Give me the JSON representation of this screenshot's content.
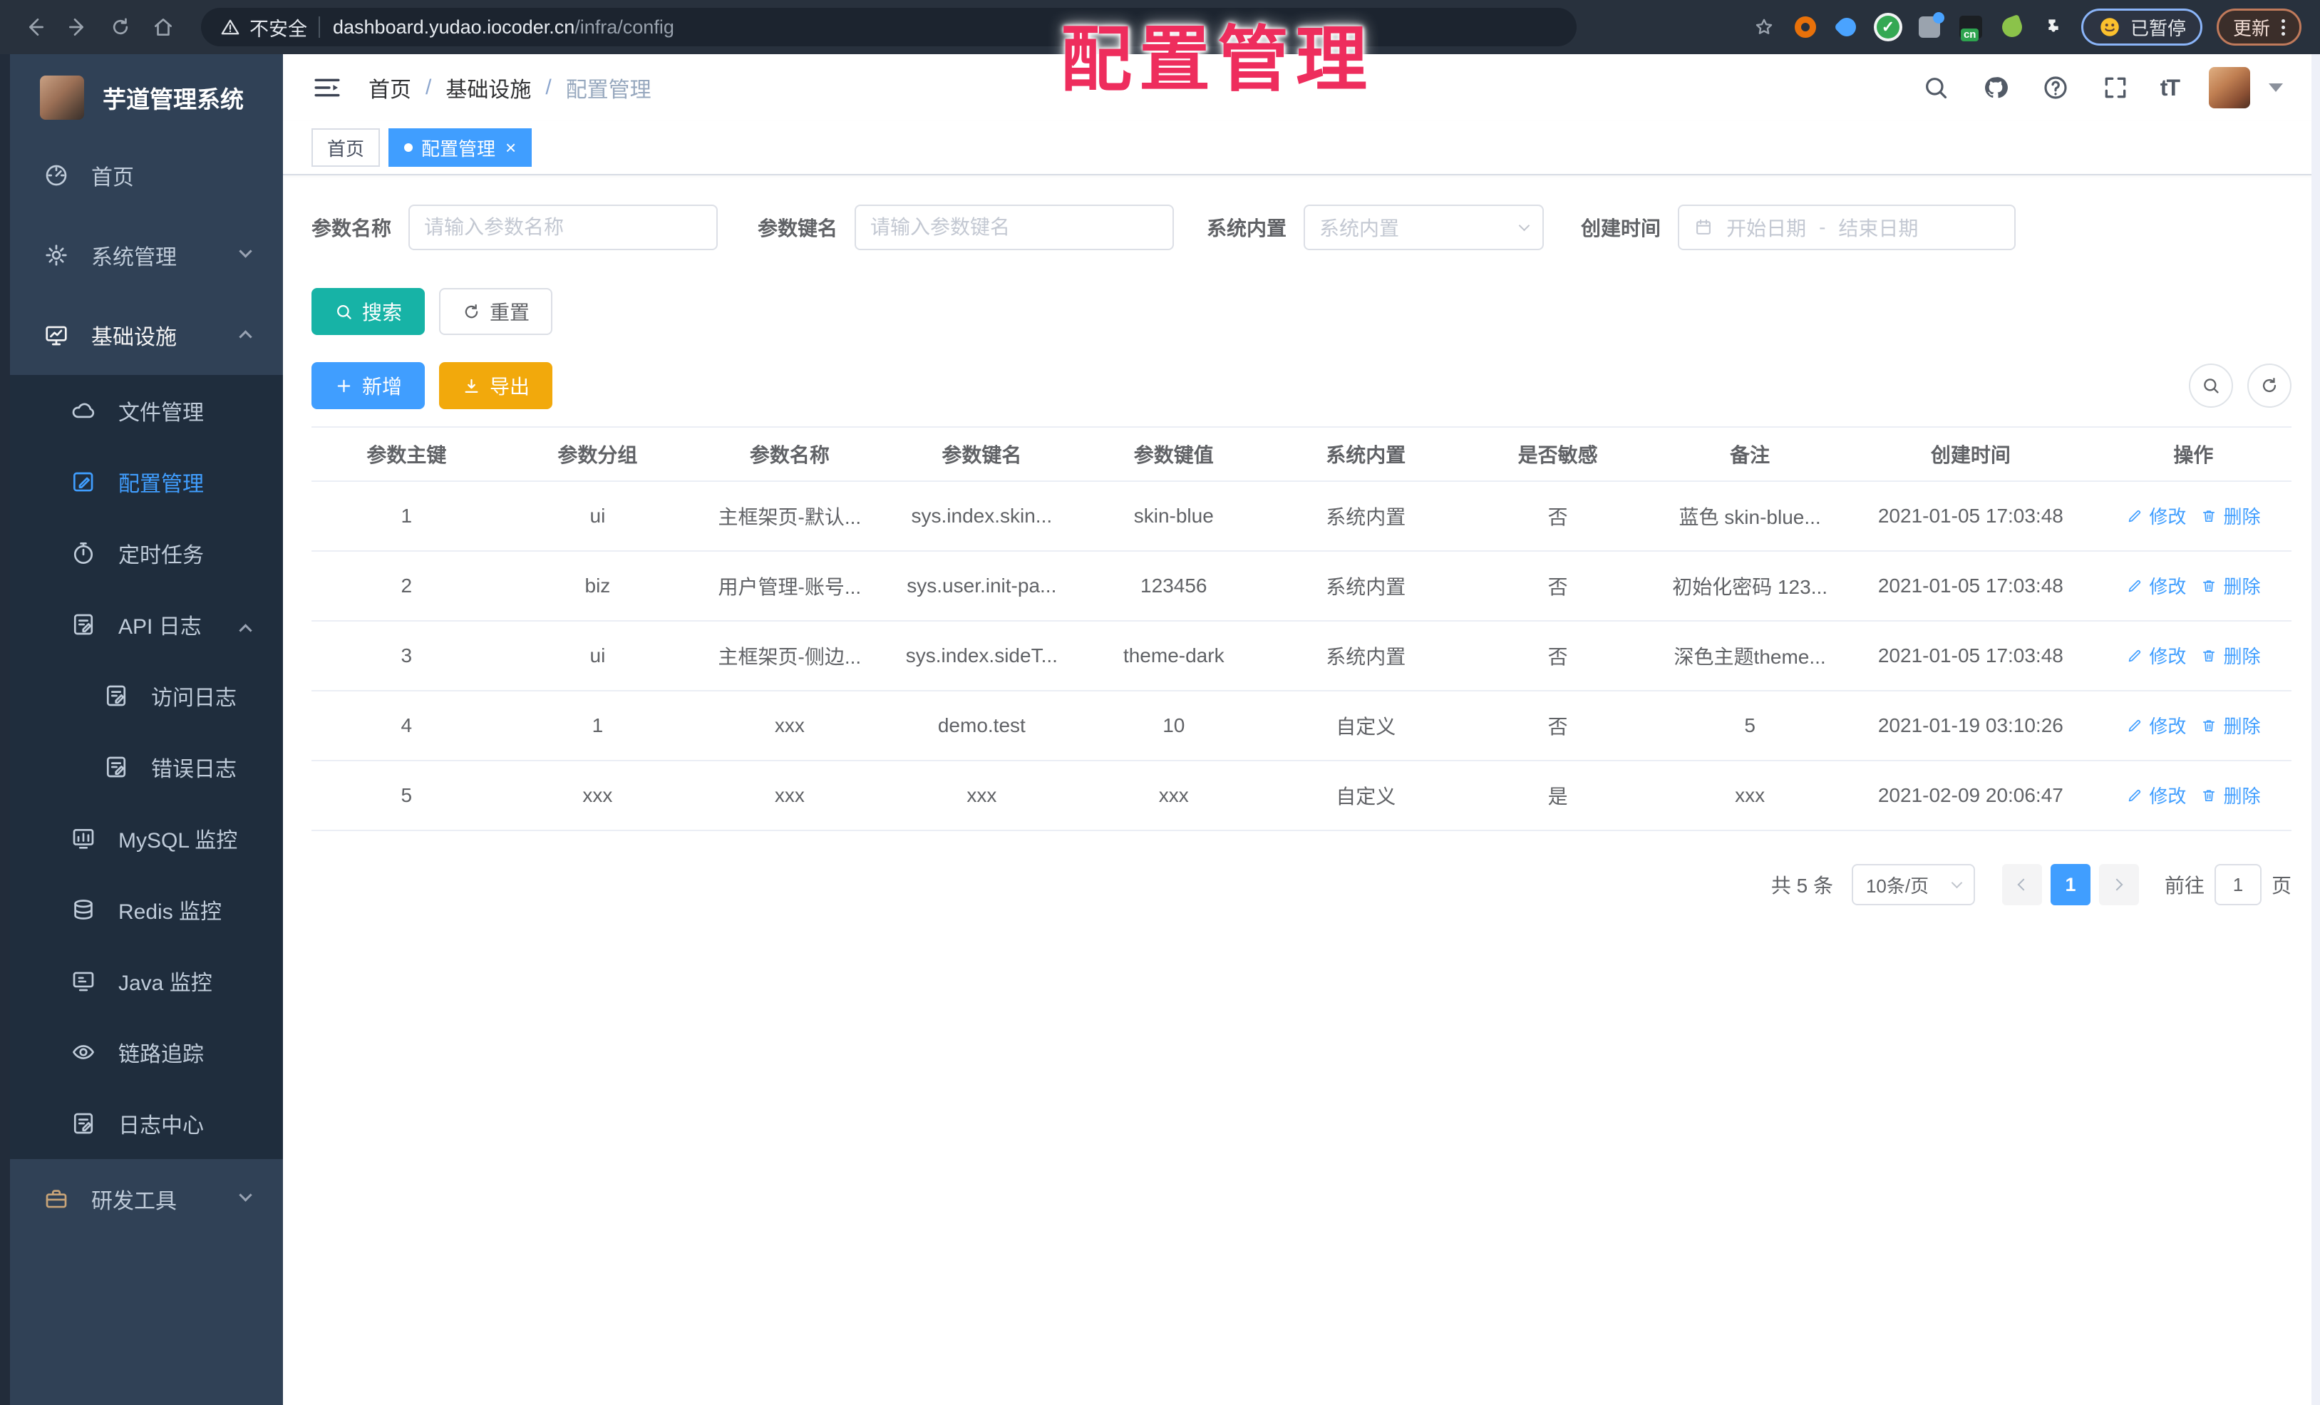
{
  "browser": {
    "security_label": "不安全",
    "url_host": "dashboard.yudao.iocoder.cn",
    "url_path": "/infra/config",
    "cn_badge": "cn",
    "paused_label": "已暂停",
    "update_label": "更新"
  },
  "overlay": {
    "title": "配置管理"
  },
  "sidebar": {
    "title": "芋道管理系统",
    "items": [
      {
        "label": "首页",
        "icon": "dashboard",
        "depth": 0,
        "zone": "top"
      },
      {
        "label": "系统管理",
        "icon": "gear",
        "depth": 0,
        "zone": "top",
        "chevron": "down"
      },
      {
        "label": "基础设施",
        "icon": "monitor",
        "depth": 0,
        "zone": "top",
        "chevron": "up",
        "state": "parent"
      },
      {
        "label": "文件管理",
        "icon": "cloud",
        "depth": 1,
        "zone": "sub"
      },
      {
        "label": "配置管理",
        "icon": "edit-square",
        "depth": 1,
        "zone": "sub",
        "state": "active"
      },
      {
        "label": "定时任务",
        "icon": "timer",
        "depth": 1,
        "zone": "sub"
      },
      {
        "label": "API 日志",
        "icon": "doc-edit",
        "depth": 1,
        "zone": "sub",
        "chevron": "up"
      },
      {
        "label": "访问日志",
        "icon": "doc-edit",
        "depth": 2,
        "zone": "sub"
      },
      {
        "label": "错误日志",
        "icon": "doc-edit",
        "depth": 2,
        "zone": "sub"
      },
      {
        "label": "MySQL 监控",
        "icon": "chart",
        "depth": 1,
        "zone": "sub"
      },
      {
        "label": "Redis 监控",
        "icon": "layers",
        "depth": 1,
        "zone": "sub"
      },
      {
        "label": "Java 监控",
        "icon": "screen",
        "depth": 1,
        "zone": "sub"
      },
      {
        "label": "链路追踪",
        "icon": "eye",
        "depth": 1,
        "zone": "sub"
      },
      {
        "label": "日志中心",
        "icon": "doc-edit",
        "depth": 1,
        "zone": "sub"
      },
      {
        "label": "研发工具",
        "icon": "toolbox",
        "depth": 0,
        "zone": "top",
        "chevron": "down",
        "tint": "#c8a478"
      }
    ]
  },
  "header": {
    "breadcrumb": [
      "首页",
      "基础设施",
      "配置管理"
    ],
    "separator": "/",
    "font_icon_text": "tT"
  },
  "tags": {
    "home": "首页",
    "active": "配置管理",
    "close_glyph": "×"
  },
  "filters": {
    "name_label": "参数名称",
    "name_placeholder": "请输入参数名称",
    "key_label": "参数键名",
    "key_placeholder": "请输入参数键名",
    "builtin_label": "系统内置",
    "builtin_placeholder": "系统内置",
    "time_label": "创建时间",
    "start_placeholder": "开始日期",
    "range_separator": "-",
    "end_placeholder": "结束日期",
    "search_label": "搜索",
    "reset_label": "重置"
  },
  "toolbar": {
    "add_label": "新增",
    "export_label": "导出"
  },
  "table": {
    "columns": [
      "参数主键",
      "参数分组",
      "参数名称",
      "参数键名",
      "参数键值",
      "系统内置",
      "是否敏感",
      "备注",
      "创建时间",
      "操作"
    ],
    "col_widths": [
      9.6,
      9.7,
      9.7,
      9.7,
      9.7,
      9.7,
      9.7,
      9.7,
      12.6,
      9.9
    ],
    "rows": [
      [
        "1",
        "ui",
        "主框架页-默认...",
        "sys.index.skin...",
        "skin-blue",
        "系统内置",
        "否",
        "蓝色 skin-blue...",
        "2021-01-05 17:03:48"
      ],
      [
        "2",
        "biz",
        "用户管理-账号...",
        "sys.user.init-pa...",
        "123456",
        "系统内置",
        "否",
        "初始化密码 123...",
        "2021-01-05 17:03:48"
      ],
      [
        "3",
        "ui",
        "主框架页-侧边...",
        "sys.index.sideT...",
        "theme-dark",
        "系统内置",
        "否",
        "深色主题theme...",
        "2021-01-05 17:03:48"
      ],
      [
        "4",
        "1",
        "xxx",
        "demo.test",
        "10",
        "自定义",
        "否",
        "5",
        "2021-01-19 03:10:26"
      ],
      [
        "5",
        "xxx",
        "xxx",
        "xxx",
        "xxx",
        "自定义",
        "是",
        "xxx",
        "2021-02-09 20:06:47"
      ]
    ],
    "edit_label": "修改",
    "delete_label": "删除"
  },
  "pagination": {
    "total_text": "共 5 条",
    "page_size": "10条/页",
    "current_page": "1",
    "goto_label": "前往",
    "goto_value": "1",
    "page_unit": "页"
  },
  "colors": {
    "primary": "#409EFF",
    "search_teal": "#17B3A6",
    "export_amber": "#F2A90C",
    "sidebar_bg": "#304156",
    "submenu_bg": "#1F2D3D",
    "overlay_red": "#EE2D5D"
  }
}
